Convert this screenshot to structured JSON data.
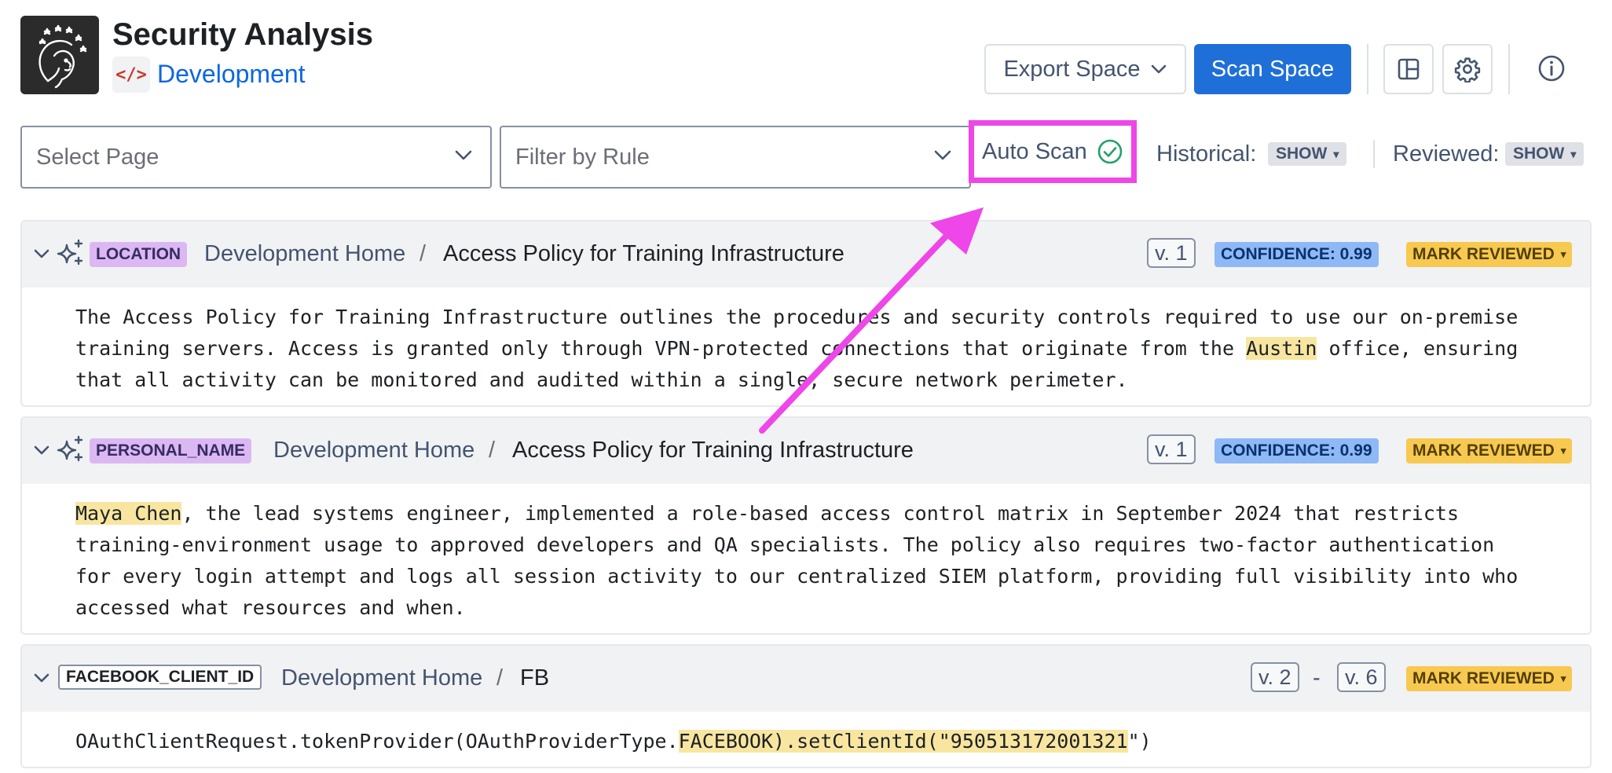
{
  "header": {
    "title": "Security Analysis",
    "space_icon_text": "</>",
    "space_name": "Development",
    "export_label": "Export Space",
    "scan_label": "Scan Space"
  },
  "filters": {
    "page_placeholder": "Select Page",
    "rule_placeholder": "Filter by Rule",
    "auto_scan_label": "Auto Scan",
    "historical_label": "Historical:",
    "historical_value": "SHOW",
    "reviewed_label": "Reviewed:",
    "reviewed_value": "SHOW"
  },
  "results": [
    {
      "rule": "LOCATION",
      "breadcrumb_home": "Development Home",
      "breadcrumb_sep": "/",
      "page_title": "Access Policy for Training Infrastructure",
      "version": "v. 1",
      "confidence": "CONFIDENCE: 0.99",
      "mark_reviewed": "MARK REVIEWED",
      "text_before": "The Access Policy for Training Infrastructure outlines the procedures and security controls required to use our on-premise training servers. Access is granted only through VPN-protected connections that originate from the ",
      "highlight": "Austin",
      "text_after": " office, ensuring that all activity can be monitored and audited within a single, secure network perimeter."
    },
    {
      "rule": "PERSONAL_NAME",
      "breadcrumb_home": "Development Home",
      "breadcrumb_sep": "/",
      "page_title": "Access Policy for Training Infrastructure",
      "version": "v. 1",
      "confidence": "CONFIDENCE: 0.99",
      "mark_reviewed": "MARK REVIEWED",
      "text_before": "",
      "highlight": "Maya Chen",
      "text_after": ", the lead systems engineer, implemented a role-based access control matrix in September 2024 that restricts training-environment usage to approved developers and QA specialists. The policy also requires two-factor authentication for every login attempt and logs all session activity to our centralized SIEM platform, providing full visibility into who accessed what resources and when."
    },
    {
      "rule": "FACEBOOK_CLIENT_ID",
      "breadcrumb_home": "Development Home",
      "breadcrumb_sep": "/",
      "page_title": "FB",
      "version_from": "v. 2",
      "version_dash": "-",
      "version_to": "v. 6",
      "mark_reviewed": "MARK REVIEWED",
      "text_before": "OAuthClientRequest.tokenProvider(OAuthProviderType.",
      "highlight": "FACEBOOK).setClientId(\"950513172001321",
      "text_after": "\")"
    }
  ],
  "icons": {
    "logo": "woman-portrait-logo",
    "space": "code-icon",
    "export_caret": "chevron-down-icon",
    "layout": "layout-icon",
    "settings": "gear-icon",
    "info": "info-icon",
    "auto_scan_status": "check-circle-icon",
    "expand": "chevron-down-icon",
    "ai_detection": "sparkle-icon"
  },
  "colors": {
    "primary": "#1f6fd8",
    "link": "#0c66e4",
    "tag_purple": "#dcb8f2",
    "confidence": "#8fb8f6",
    "mark_reviewed": "#f8c951",
    "highlight": "#f8e6a0",
    "annotation": "#ee46e8",
    "success": "#22a06b"
  }
}
